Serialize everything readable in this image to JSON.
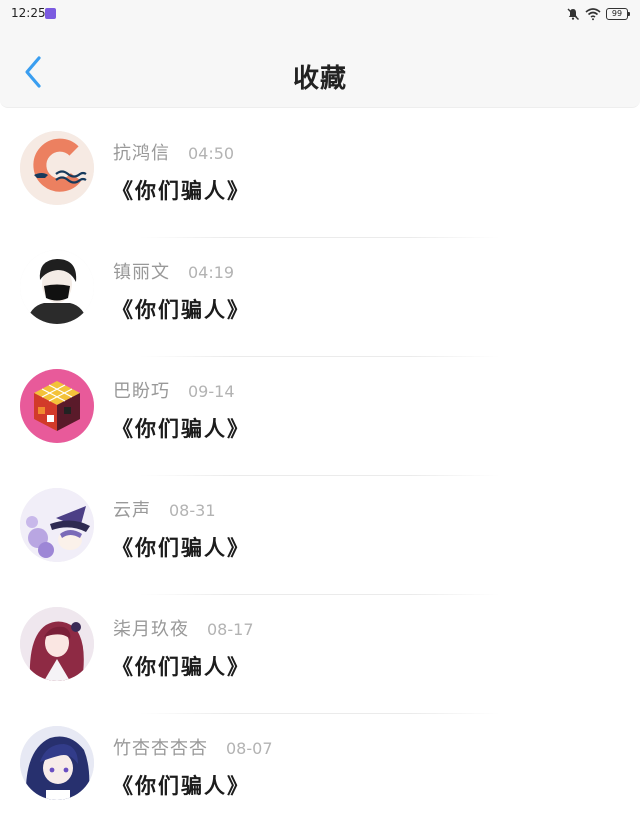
{
  "status_bar": {
    "time": "12:25",
    "battery": "99",
    "icons": [
      "app-notification-icon",
      "mute-icon",
      "wifi-icon",
      "battery-icon"
    ]
  },
  "header": {
    "title": "收藏",
    "back_icon": "chevron-left-icon",
    "accent_color": "#3a9ef0"
  },
  "items": [
    {
      "name": "抗鸿信",
      "time": "04:50",
      "text": "《你们骗人》",
      "avatar": "orange-logo-avatar"
    },
    {
      "name": "镇丽文",
      "time": "04:19",
      "text": "《你们骗人》",
      "avatar": "masked-boy-avatar"
    },
    {
      "name": "巴盼巧",
      "time": "09-14",
      "text": "《你们骗人》",
      "avatar": "rubiks-cube-avatar"
    },
    {
      "name": "云声",
      "time": "08-31",
      "text": "《你们骗人》",
      "avatar": "witch-hat-anime-avatar"
    },
    {
      "name": "柒月玖夜",
      "time": "08-17",
      "text": "《你们骗人》",
      "avatar": "red-hair-anime-avatar"
    },
    {
      "name": "竹杏杏杏杏",
      "time": "08-07",
      "text": "《你们骗人》",
      "avatar": "blue-hair-anime-avatar"
    }
  ]
}
